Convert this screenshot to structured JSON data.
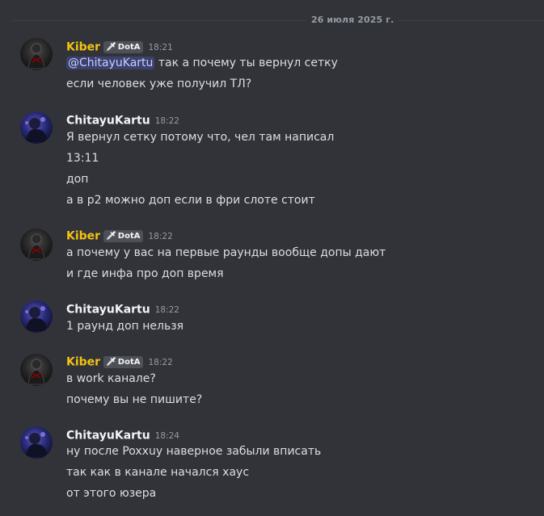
{
  "date_divider": "26 июля 2025 г.",
  "messages": [
    {
      "author": "Kiber",
      "tag": "DotA",
      "time": "18:21",
      "mention": "@ChitayuKartu",
      "lines": [
        "так а почему ты вернул сетку",
        "если человек уже получил ТЛ?"
      ]
    },
    {
      "author": "ChitayuKartu",
      "time": "18:22",
      "lines": [
        "Я вернул сетку потому что, чел там написал",
        "13:11",
        "доп",
        "а в р2 можно доп если в фри слоте стоит"
      ]
    },
    {
      "author": "Kiber",
      "tag": "DotA",
      "time": "18:22",
      "lines": [
        "а почему у вас на первые раунды вообще допы дают",
        "и где инфа про доп время"
      ]
    },
    {
      "author": "ChitayuKartu",
      "time": "18:22",
      "lines": [
        "1 раунд доп нельзя"
      ]
    },
    {
      "author": "Kiber",
      "tag": "DotA",
      "time": "18:22",
      "lines": [
        "в work канале?",
        "почему вы не пишите?"
      ]
    },
    {
      "author": "ChitayuKartu",
      "time": "18:24",
      "lines": [
        "ну после Poxxuy наверное забыли вписать",
        "так как в канале начался хаус",
        "от этого юзера"
      ]
    }
  ],
  "colors": {
    "background": "#323339",
    "kiber_name": "#f1c40f",
    "chitayu_name": "#f2f3f5",
    "mention_bg": "#3c4270",
    "timestamp": "#949ba4"
  },
  "icons": {
    "tag_icon": "dota-sword-icon"
  }
}
